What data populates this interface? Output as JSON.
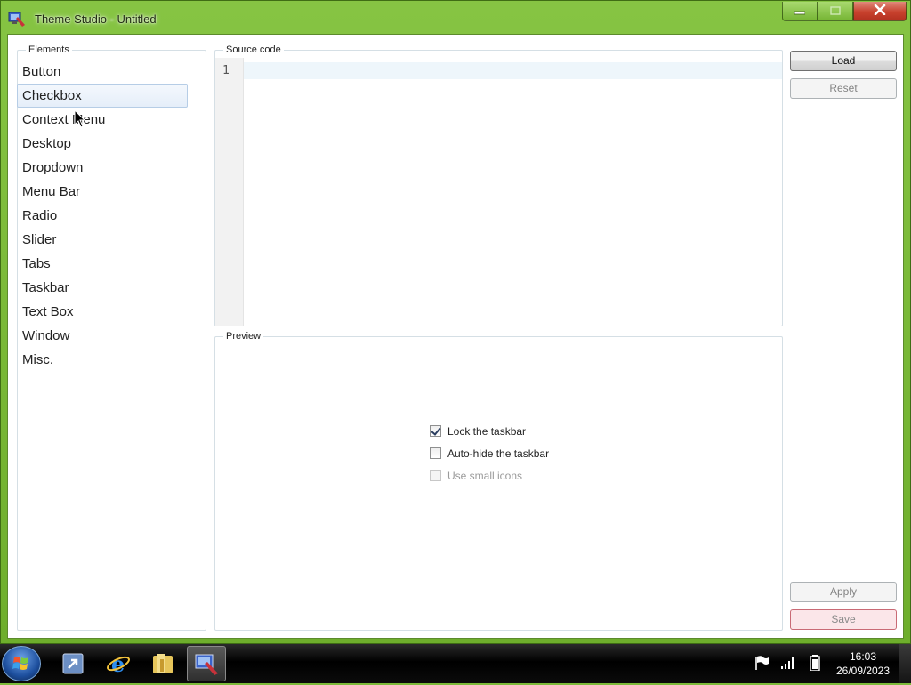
{
  "window": {
    "title": "Theme Studio - Untitled"
  },
  "elements": {
    "legend": "Elements",
    "items": [
      {
        "label": "Button",
        "selected": false
      },
      {
        "label": "Checkbox",
        "selected": true
      },
      {
        "label": "Context Menu",
        "selected": false
      },
      {
        "label": "Desktop",
        "selected": false
      },
      {
        "label": "Dropdown",
        "selected": false
      },
      {
        "label": "Menu Bar",
        "selected": false
      },
      {
        "label": "Radio",
        "selected": false
      },
      {
        "label": "Slider",
        "selected": false
      },
      {
        "label": "Tabs",
        "selected": false
      },
      {
        "label": "Taskbar",
        "selected": false
      },
      {
        "label": "Text Box",
        "selected": false
      },
      {
        "label": "Window",
        "selected": false
      },
      {
        "label": "Misc.",
        "selected": false
      }
    ]
  },
  "source": {
    "legend": "Source code",
    "line_number": "1",
    "code": ""
  },
  "preview": {
    "legend": "Preview",
    "checkboxes": [
      {
        "label": "Lock the taskbar",
        "checked": true,
        "disabled": false
      },
      {
        "label": "Auto-hide the taskbar",
        "checked": false,
        "disabled": false
      },
      {
        "label": "Use small icons",
        "checked": false,
        "disabled": true
      }
    ]
  },
  "buttons": {
    "load": "Load",
    "reset": "Reset",
    "apply": "Apply",
    "save": "Save"
  },
  "taskbar": {
    "time": "16:03",
    "date": "26/09/2023"
  },
  "colors": {
    "frame": "#7dbb3a",
    "close_button": "#c8412d",
    "selection": "#e5eef9"
  }
}
